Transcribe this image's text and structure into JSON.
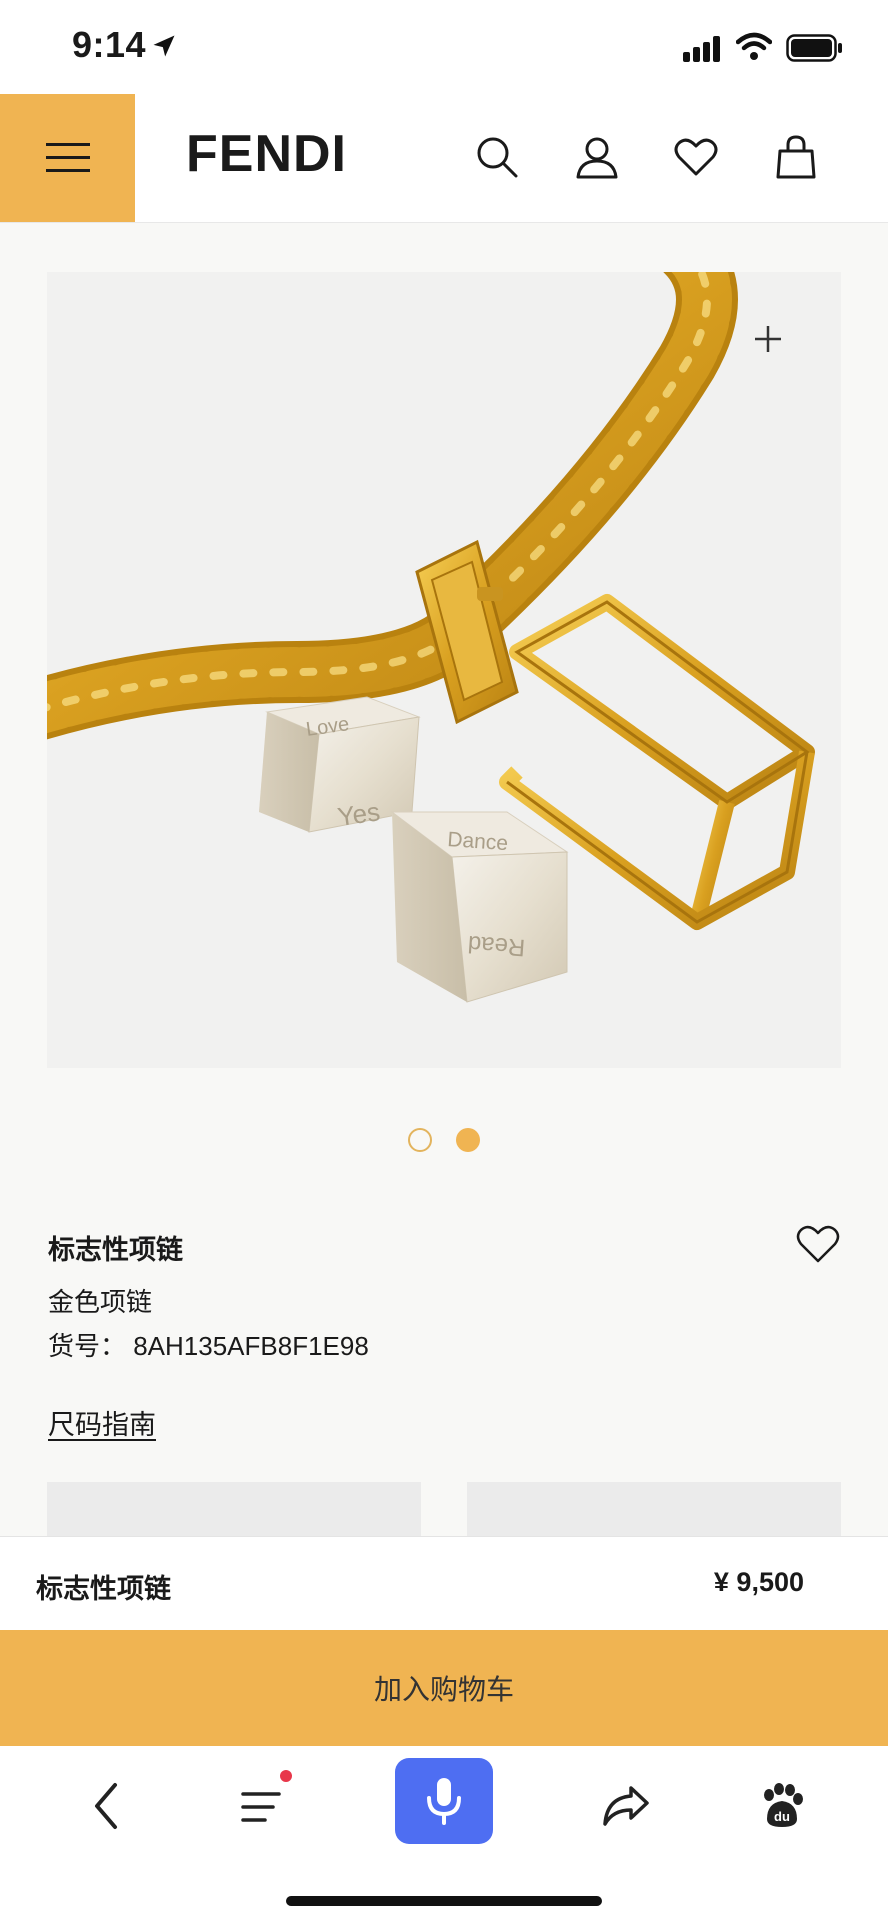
{
  "status_bar": {
    "time": "9:14",
    "icons": [
      "location-arrow-icon",
      "signal-icon",
      "wifi-icon",
      "battery-icon"
    ]
  },
  "header": {
    "logo": "FENDI",
    "icons": [
      "menu-icon",
      "search-icon",
      "account-icon",
      "heart-icon",
      "bag-icon"
    ],
    "accent_color": "#f0b452"
  },
  "gallery": {
    "image_count": 2,
    "active_index": 1,
    "cube_words": [
      "Love",
      "Yes",
      "Dance",
      "Read"
    ]
  },
  "product": {
    "name": "标志性项链",
    "color": "金色项链",
    "sku": "货号：  8AH135AFB8F1E98",
    "size_guide": "尺码指南"
  },
  "sticky_bar": {
    "name": "标志性项链",
    "price": "¥  9,500"
  },
  "cart": {
    "label": "加入购物车"
  },
  "browser_toolbar": {
    "icons": [
      "back-icon",
      "menu-list-icon",
      "microphone-icon",
      "share-icon",
      "baidu-paw-icon"
    ],
    "mic_color": "#4e6ef2"
  }
}
